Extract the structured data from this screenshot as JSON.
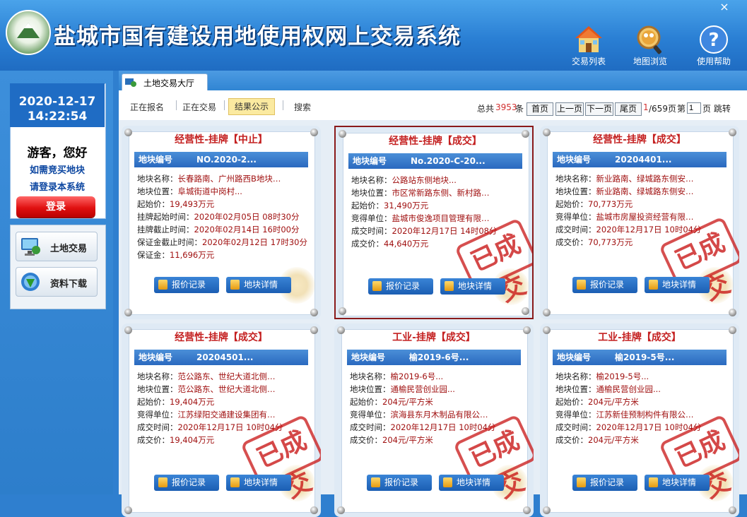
{
  "header": {
    "title": "盐城市国有建设用地使用权网上交易系统",
    "close_label": "×",
    "tools": [
      {
        "label": "交易列表",
        "icon": "house-icon"
      },
      {
        "label": "地图浏览",
        "icon": "map-magnifier-icon"
      },
      {
        "label": "使用帮助",
        "icon": "help-icon"
      }
    ]
  },
  "sidebar": {
    "date": "2020-12-17",
    "time": "14:22:54",
    "guest": "游客，您好",
    "note1": "如需竞买地块",
    "note2": "请登录本系统",
    "login_label": "登录",
    "nav": [
      {
        "label": "土地交易",
        "icon": "monitor-globe-icon"
      },
      {
        "label": "资料下载",
        "icon": "download-globe-icon"
      }
    ]
  },
  "tab": {
    "label": "土地交易大厅"
  },
  "filters": {
    "items": [
      "正在报名",
      "正在交易",
      "结果公示",
      "搜索"
    ],
    "active": "结果公示"
  },
  "pager": {
    "total_prefix": "总共",
    "total": "3953",
    "total_suffix": "条",
    "first": "首页",
    "prev": "上一页",
    "next": "下一页",
    "last": "尾页",
    "current": "1",
    "pages": "/659页",
    "jump_prefix": "第",
    "jump_value": "1",
    "jump_suffix": "页 跳转"
  },
  "card_labels": {
    "bar_label": "地块编号",
    "record_button": "报价记录",
    "detail_button": "地块详情",
    "stamp": "已成交"
  },
  "cards": [
    {
      "title": "经营性-挂牌【中止】",
      "code": "NO.2020-2...",
      "lines": [
        {
          "label": "地块名称：",
          "value": "长春路南、广州路西B地块…"
        },
        {
          "label": "地块位置：",
          "value": "阜城街道中岗村..."
        },
        {
          "label": "起始价：",
          "value": "19,493万元"
        },
        {
          "label": "挂牌起始时间：",
          "value": "2020年02月05日 08时30分"
        },
        {
          "label": "挂牌截止时间：",
          "value": "2020年02月14日 16时00分"
        },
        {
          "label": "保证金截止时间：",
          "value": "2020年02月12日 17时30分"
        },
        {
          "label": "保证金：",
          "value": "11,696万元"
        }
      ],
      "stamped": false
    },
    {
      "title": "经营性-挂牌【成交】",
      "code": "No.2020-C-20...",
      "lines": [
        {
          "label": "地块名称：",
          "value": "公路站东侧地块..."
        },
        {
          "label": "地块位置：",
          "value": "市区常新路东侧、新村路…"
        },
        {
          "label": "起始价：",
          "value": "31,490万元"
        },
        {
          "label": "竞得单位：",
          "value": "盐城市俊逸项目管理有限…"
        },
        {
          "label": "成交时间：",
          "value": "2020年12月17日 14时08分"
        },
        {
          "label": "成交价：",
          "value": "44,640万元"
        }
      ],
      "stamped": true
    },
    {
      "title": "经营性-挂牌【成交】",
      "code": "20204401...",
      "lines": [
        {
          "label": "地块名称：",
          "value": "新业路南、绿城路东侧安…"
        },
        {
          "label": "地块位置：",
          "value": "新业路南、绿城路东侧安…"
        },
        {
          "label": "起始价：",
          "value": "70,773万元"
        },
        {
          "label": "竞得单位：",
          "value": "盐城市房屋投资经营有限…"
        },
        {
          "label": "成交时间：",
          "value": "2020年12月17日 10时04分"
        },
        {
          "label": "成交价：",
          "value": "70,773万元"
        }
      ],
      "stamped": true
    },
    {
      "title": "经营性-挂牌【成交】",
      "code": "20204501...",
      "lines": [
        {
          "label": "地块名称：",
          "value": "范公路东、世纪大道北侧…"
        },
        {
          "label": "地块位置：",
          "value": "范公路东、世纪大道北侧…"
        },
        {
          "label": "起始价：",
          "value": "19,404万元"
        },
        {
          "label": "竞得单位：",
          "value": "江苏绿阳交通建设集团有…"
        },
        {
          "label": "成交时间：",
          "value": "2020年12月17日 10时04分"
        },
        {
          "label": "成交价：",
          "value": "19,404万元"
        }
      ],
      "stamped": true
    },
    {
      "title": "工业-挂牌【成交】",
      "code": "榆2019-6号...",
      "lines": [
        {
          "label": "地块名称：",
          "value": "榆2019-6号..."
        },
        {
          "label": "地块位置：",
          "value": "通榆民营创业园..."
        },
        {
          "label": "起始价：",
          "value": "204元/平方米"
        },
        {
          "label": "竞得单位：",
          "value": "滨海县东月木制品有限公…"
        },
        {
          "label": "成交时间：",
          "value": "2020年12月17日 10时04分"
        },
        {
          "label": "成交价：",
          "value": "204元/平方米"
        }
      ],
      "stamped": true
    },
    {
      "title": "工业-挂牌【成交】",
      "code": "榆2019-5号...",
      "lines": [
        {
          "label": "地块名称：",
          "value": "榆2019-5号..."
        },
        {
          "label": "地块位置：",
          "value": "通榆民营创业园..."
        },
        {
          "label": "起始价：",
          "value": "204元/平方米"
        },
        {
          "label": "竞得单位：",
          "value": "江苏新佳预制构件有限公…"
        },
        {
          "label": "成交时间：",
          "value": "2020年12月17日 10时04分"
        },
        {
          "label": "成交价：",
          "value": "204元/平方米"
        }
      ],
      "stamped": true
    }
  ]
}
